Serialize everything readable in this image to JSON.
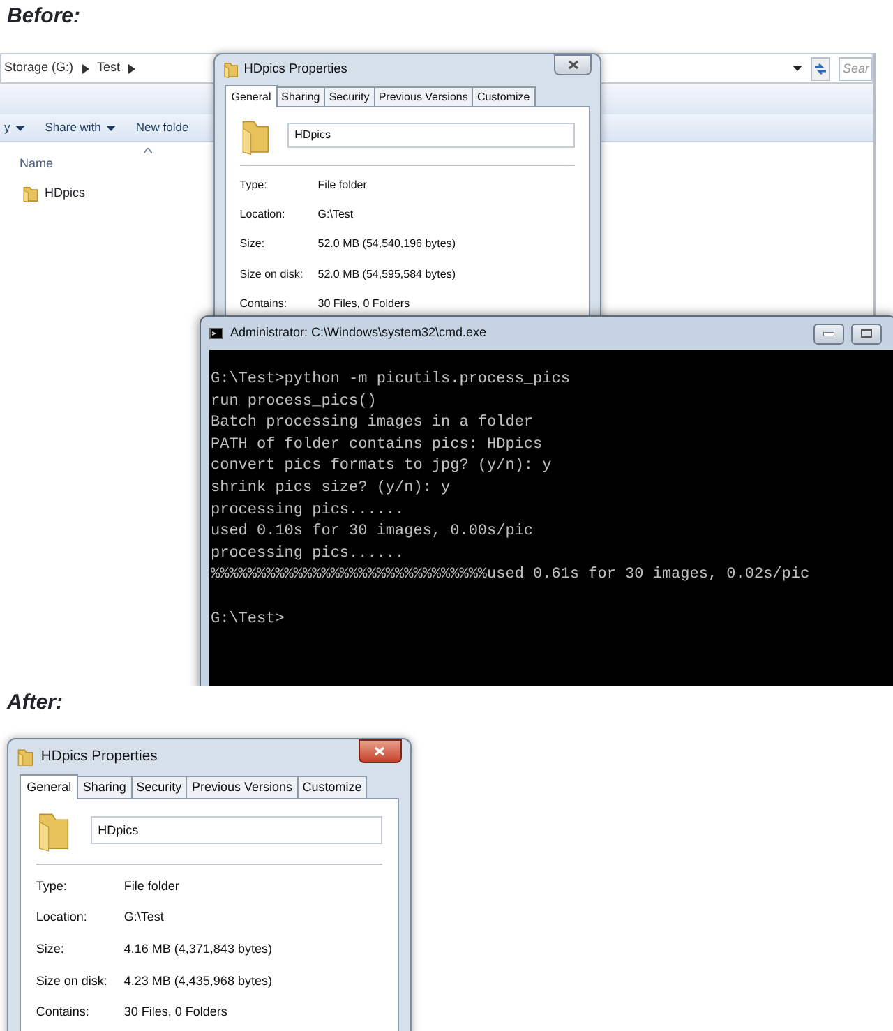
{
  "before_label": "Before:",
  "before": {
    "explorer": {
      "breadcrumb": [
        "Storage (G:)",
        "Test"
      ],
      "search_placeholder": "Sear",
      "toolbar": [
        {
          "label": "y",
          "dropdown": true
        },
        {
          "label": "Share with",
          "dropdown": true
        },
        {
          "label": "New folde",
          "dropdown": false
        }
      ],
      "column_header": "Name",
      "items": [
        {
          "name": "HDpics"
        }
      ]
    },
    "properties_dialog": {
      "title": "HDpics Properties",
      "close_highlighted": false,
      "tabs": [
        {
          "label": "General",
          "selected": true
        },
        {
          "label": "Sharing",
          "selected": false
        },
        {
          "label": "Security",
          "selected": false
        },
        {
          "label": "Previous Versions",
          "selected": false
        },
        {
          "label": "Customize",
          "selected": false
        }
      ],
      "name": "HDpics",
      "properties": [
        {
          "label": "Type:",
          "value": "File folder"
        },
        {
          "label": "Location:",
          "value": "G:\\Test"
        },
        {
          "label": "Size:",
          "value": "52.0 MB (54,540,196 bytes)"
        },
        {
          "label": "Size on disk:",
          "value": "52.0 MB (54,595,584 bytes)"
        },
        {
          "label": "Contains:",
          "value": "30 Files, 0 Folders"
        }
      ]
    },
    "console": {
      "title": "Administrator: C:\\Windows\\system32\\cmd.exe",
      "output": [
        "G:\\Test>python -m picutils.process_pics",
        "run process_pics()",
        "Batch processing images in a folder",
        "PATH of folder contains pics: HDpics",
        "convert pics formats to jpg? (y/n): y",
        "shrink pics size? (y/n): y",
        "processing pics......",
        "used 0.10s for 30 images, 0.00s/pic",
        "processing pics......",
        "%%%%%%%%%%%%%%%%%%%%%%%%%%%%%%used 0.61s for 30 images, 0.02s/pic"
      ],
      "prompt": "G:\\Test>"
    }
  },
  "after_label": "After:",
  "after": {
    "properties_dialog": {
      "title": "HDpics Properties",
      "close_highlighted": true,
      "tabs": [
        {
          "label": "General",
          "selected": true
        },
        {
          "label": "Sharing",
          "selected": false
        },
        {
          "label": "Security",
          "selected": false
        },
        {
          "label": "Previous Versions",
          "selected": false
        },
        {
          "label": "Customize",
          "selected": false
        }
      ],
      "name": "HDpics",
      "properties": [
        {
          "label": "Type:",
          "value": "File folder"
        },
        {
          "label": "Location:",
          "value": "G:\\Test"
        },
        {
          "label": "Size:",
          "value": "4.16 MB (4,371,843 bytes)"
        },
        {
          "label": "Size on disk:",
          "value": "4.23 MB (4,435,968 bytes)"
        },
        {
          "label": "Contains:",
          "value": "30 Files, 0 Folders"
        }
      ]
    }
  }
}
